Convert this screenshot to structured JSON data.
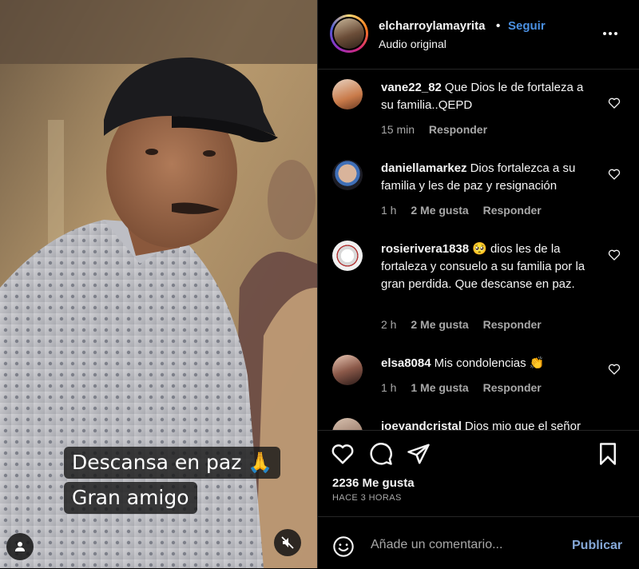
{
  "header": {
    "username": "elcharroylamayrita",
    "separator": "•",
    "follow_label": "Seguir",
    "audio_label": "Audio original",
    "more_icon": "more-horizontal-icon"
  },
  "media": {
    "caption_line1": "Descansa en paz 🙏",
    "caption_line2": "Gran amigo"
  },
  "comments": [
    {
      "user": "vane22_82",
      "text": "Que Dios le de fortaleza a su familia..QEPD",
      "time": "15 min",
      "likes": "",
      "reply": "Responder"
    },
    {
      "user": "daniellamarkez",
      "text": "Dios fortalezca a su familia y les de paz y resignación",
      "time": "1 h",
      "likes": "2 Me gusta",
      "reply": "Responder"
    },
    {
      "user": "rosierivera1838",
      "text": "🥺 dios les de la fortaleza y consuelo a su familia por la gran perdida. Que descanse en paz.",
      "time": "2 h",
      "likes": "2 Me gusta",
      "reply": "Responder"
    },
    {
      "user": "elsa8084",
      "text": "Mis condolencias 👏",
      "time": "1 h",
      "likes": "1 Me gusta",
      "reply": "Responder"
    },
    {
      "user": "joeyandcristal",
      "text": "Dios mio que el señor",
      "time": "",
      "likes": "",
      "reply": ""
    }
  ],
  "actions": {
    "likes_text": "2236 Me gusta",
    "posted_text": "HACE 3 HORAS"
  },
  "composer": {
    "placeholder": "Añade un comentario...",
    "publish_label": "Publicar"
  },
  "colors": {
    "accent": "#4a90e2",
    "publish": "#85a8d8",
    "secondary_text": "#a8a8a8",
    "divider": "#262626"
  }
}
